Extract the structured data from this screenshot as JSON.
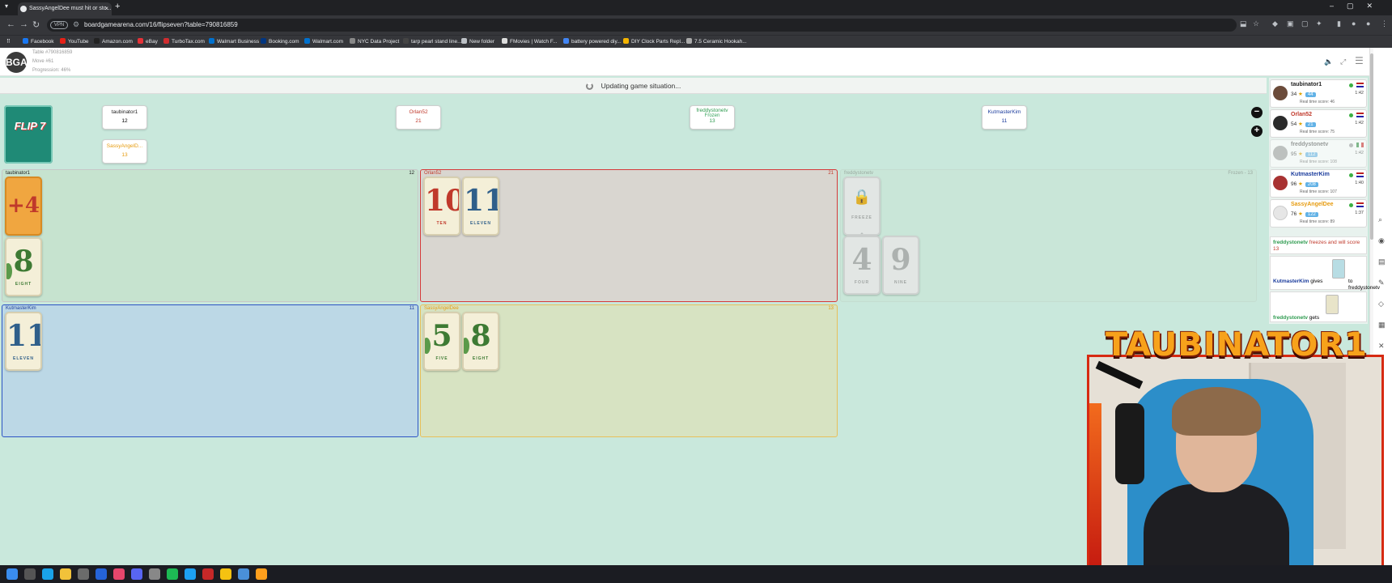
{
  "browser": {
    "tab_title": "SassyAngelDee must hit or sto...",
    "url": "boardgamearena.com/16/flipseven?table=790816859",
    "vpn_label": "VPN",
    "bookmarks": [
      "Facebook",
      "YouTube",
      "Amazon.com",
      "eBay",
      "TurboTax.com",
      "Walmart Business",
      "Booking.com",
      "Walmart.com",
      "NYC Data Project",
      "tarp pearl stand line...",
      "New folder",
      "FMovies | Watch F...",
      "battery powered diy...",
      "DIY Clock Parts Repl...",
      "7.5 Ceramic Hookah..."
    ]
  },
  "game_header": {
    "logo": "BGA",
    "table_label": "Table #790816859",
    "move_label": "Move #61",
    "progression_label": "Progression: 46%"
  },
  "status": {
    "message": "Updating game situation..."
  },
  "deck": {
    "label": "FLIP 7"
  },
  "top_tags": [
    {
      "name": "taubinator1",
      "points": "12",
      "color": "#222222"
    },
    {
      "name": "Orlan52",
      "points": "21",
      "color": "#c0392b"
    },
    {
      "name": "freddystonetv",
      "sub": "Frozen",
      "points": "13",
      "color": "#2e9b4f"
    },
    {
      "name": "KutmasterKim",
      "points": "11",
      "color": "#1a3b9c"
    },
    {
      "name": "SassyAngelD...",
      "points": "13",
      "color": "#e69b0f"
    }
  ],
  "zones": [
    {
      "player": "taubinator1",
      "score": "12",
      "color": "#222222"
    },
    {
      "player": "Orlan52",
      "score": "21",
      "color": "#c0392b"
    },
    {
      "player": "freddystonetv",
      "score": "Frozen - 13",
      "color": "#2e9b4f"
    },
    {
      "player": "KutmasterKim",
      "score": "11",
      "color": "#1a3b9c"
    },
    {
      "player": "SassyAngelDee",
      "score": "13",
      "color": "#e69b0f"
    }
  ],
  "cards": {
    "taubinator1": [
      {
        "num": "+4",
        "word": ""
      },
      {
        "num": "8",
        "word": "EIGHT"
      }
    ],
    "orlan52": [
      {
        "num": "10",
        "word": "TEN"
      },
      {
        "num": "11",
        "word": "ELEVEN"
      }
    ],
    "freddystonetv": [
      {
        "num": "",
        "word": "FREEZE"
      },
      {
        "num": "4",
        "word": "FOUR"
      },
      {
        "num": "9",
        "word": "NINE"
      }
    ],
    "kutmasterkim": [
      {
        "num": "11",
        "word": "ELEVEN"
      }
    ],
    "sassyangeldee": [
      {
        "num": "5",
        "word": "FIVE"
      },
      {
        "num": "8",
        "word": "EIGHT"
      }
    ]
  },
  "players_panel": [
    {
      "name": "taubinator1",
      "score": "34",
      "badge": "44",
      "realtime": "Real time score: 46",
      "time": "1:42",
      "color": "#222222",
      "dot": "#3cb043"
    },
    {
      "name": "Orlan52",
      "score": "54",
      "badge": "21",
      "realtime": "Real time score: 75",
      "time": "1:42",
      "color": "#c0392b",
      "dot": "#3cb043"
    },
    {
      "name": "freddystonetv",
      "score": "95",
      "badge": "112",
      "realtime": "Real time score: 108",
      "time": "1:42",
      "color": "#2e9b4f",
      "dot": "#999999"
    },
    {
      "name": "KutmasterKim",
      "score": "96",
      "badge": "208",
      "realtime": "Real time score: 107",
      "time": "1:40",
      "color": "#1a3b9c",
      "dot": "#3cb043"
    },
    {
      "name": "SassyAngelDee",
      "score": "76",
      "badge": "122",
      "realtime": "Real time score: 89",
      "time": "1:37",
      "color": "#e69b0f",
      "dot": "#3cb043"
    }
  ],
  "log": [
    {
      "actor": "freddystonetv",
      "text": "freezes and will score 13"
    },
    {
      "actor": "KutmasterKim",
      "text": "gives",
      "target": "to freddystonetv"
    },
    {
      "actor": "freddystonetv",
      "text": "gets"
    }
  ],
  "webcam": {
    "overlay_name": "TAUBINATOR1"
  },
  "colors": {
    "board_bg": "#c9e8dc",
    "zone_green": "#c6e3cf",
    "zone_red": "#d9d6d0",
    "zone_blue": "#bcd8e6",
    "zone_yellow": "#d7e3c2",
    "bga_blue": "#62b2e6"
  }
}
